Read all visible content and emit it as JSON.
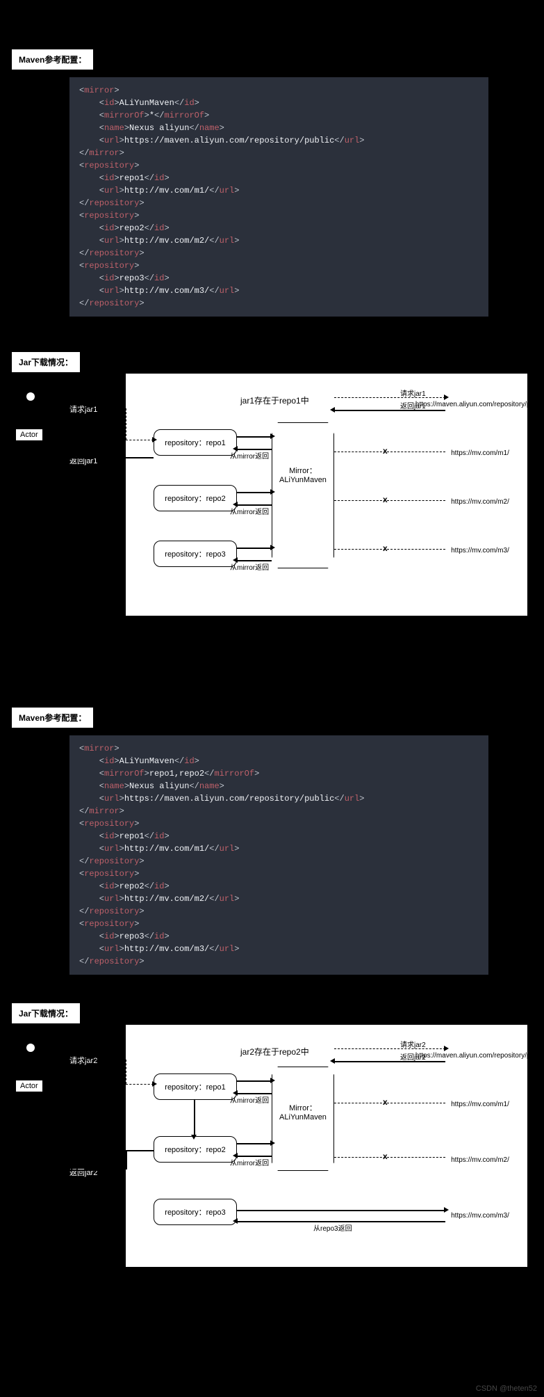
{
  "watermark": "CSDN @theten52",
  "section1": {
    "maven_label": "Maven参考配置：",
    "code": {
      "mirror_id": "ALiYunMaven",
      "mirror_of": "*",
      "mirror_name": "Nexus aliyun",
      "mirror_url": "https://maven.aliyun.com/repository/public",
      "repos": [
        {
          "id": "repo1",
          "url": "http://mv.com/m1/"
        },
        {
          "id": "repo2",
          "url": "http://mv.com/m2/"
        },
        {
          "id": "repo3",
          "url": "http://mv.com/m3/"
        }
      ]
    },
    "jar_label": "Jar下载情况：",
    "actor": "Actor",
    "request": "请求jar1",
    "response": "返回jar1",
    "jar_title": "jar1存在于repo1中",
    "repos": [
      "repository：repo1",
      "repository：repo2",
      "repository：repo3"
    ],
    "mirror_box": "Mirror：\nALiYunMaven",
    "mirror_return": "从mirror返回",
    "remote_request": "请求jar1",
    "remote_response": "返回jar1",
    "clouds": [
      "https://maven.aliyun.com/repository/public",
      "https://mv.com/m1/",
      "https://mv.com/m2/",
      "https://mv.com/m3/"
    ],
    "x": "x"
  },
  "section2": {
    "maven_label": "Maven参考配置：",
    "code": {
      "mirror_id": "ALiYunMaven",
      "mirror_of": "repo1,repo2",
      "mirror_name": "Nexus aliyun",
      "mirror_url": "https://maven.aliyun.com/repository/public",
      "repos": [
        {
          "id": "repo1",
          "url": "http://mv.com/m1/"
        },
        {
          "id": "repo2",
          "url": "http://mv.com/m2/"
        },
        {
          "id": "repo3",
          "url": "http://mv.com/m3/"
        }
      ]
    },
    "jar_label": "Jar下载情况：",
    "actor": "Actor",
    "request": "请求jar2",
    "response": "返回jar2",
    "jar_title": "jar2存在于repo2中",
    "repos": [
      "repository：repo1",
      "repository：repo2",
      "repository：repo3"
    ],
    "mirror_box": "Mirror：\nALiYunMaven",
    "mirror_return": "从mirror返回",
    "repo3_return": "从repo3返回",
    "remote_request": "请求jar2",
    "remote_response": "返回jar2",
    "clouds": [
      "https://maven.aliyun.com/repository/public",
      "https://mv.com/m1/",
      "https://mv.com/m2/",
      "https://mv.com/m3/"
    ],
    "x": "x"
  },
  "chart_data": [
    {
      "type": "diagram",
      "title": "jar1存在于repo1中",
      "mirror": {
        "id": "ALiYunMaven",
        "mirrorOf": "*",
        "url": "https://maven.aliyun.com/repository/public"
      },
      "repositories": [
        {
          "id": "repo1",
          "url": "http://mv.com/m1/",
          "resolved_via": "mirror",
          "blocked_direct": true
        },
        {
          "id": "repo2",
          "url": "http://mv.com/m2/",
          "resolved_via": "mirror",
          "blocked_direct": true
        },
        {
          "id": "repo3",
          "url": "http://mv.com/m3/",
          "resolved_via": "mirror",
          "blocked_direct": true
        }
      ],
      "flow": [
        "Actor 请求jar1 → repo1",
        "repo1 → Mirror(ALiYunMaven)",
        "Mirror → https://maven.aliyun.com/repository/public",
        "返回jar1 → Actor"
      ]
    },
    {
      "type": "diagram",
      "title": "jar2存在于repo2中",
      "mirror": {
        "id": "ALiYunMaven",
        "mirrorOf": "repo1,repo2",
        "url": "https://maven.aliyun.com/repository/public"
      },
      "repositories": [
        {
          "id": "repo1",
          "url": "http://mv.com/m1/",
          "resolved_via": "mirror",
          "blocked_direct": true
        },
        {
          "id": "repo2",
          "url": "http://mv.com/m2/",
          "resolved_via": "mirror",
          "blocked_direct": true
        },
        {
          "id": "repo3",
          "url": "http://mv.com/m3/",
          "resolved_via": "direct",
          "blocked_direct": false
        }
      ],
      "flow": [
        "Actor 请求jar2 → repo1",
        "repo1 → Mirror → aliyun (miss)",
        "repo1 → repo2",
        "repo2 → Mirror → aliyun",
        "返回jar2 → Actor",
        "repo3 → https://mv.com/m3/ 直接 (从repo3返回)"
      ]
    }
  ]
}
